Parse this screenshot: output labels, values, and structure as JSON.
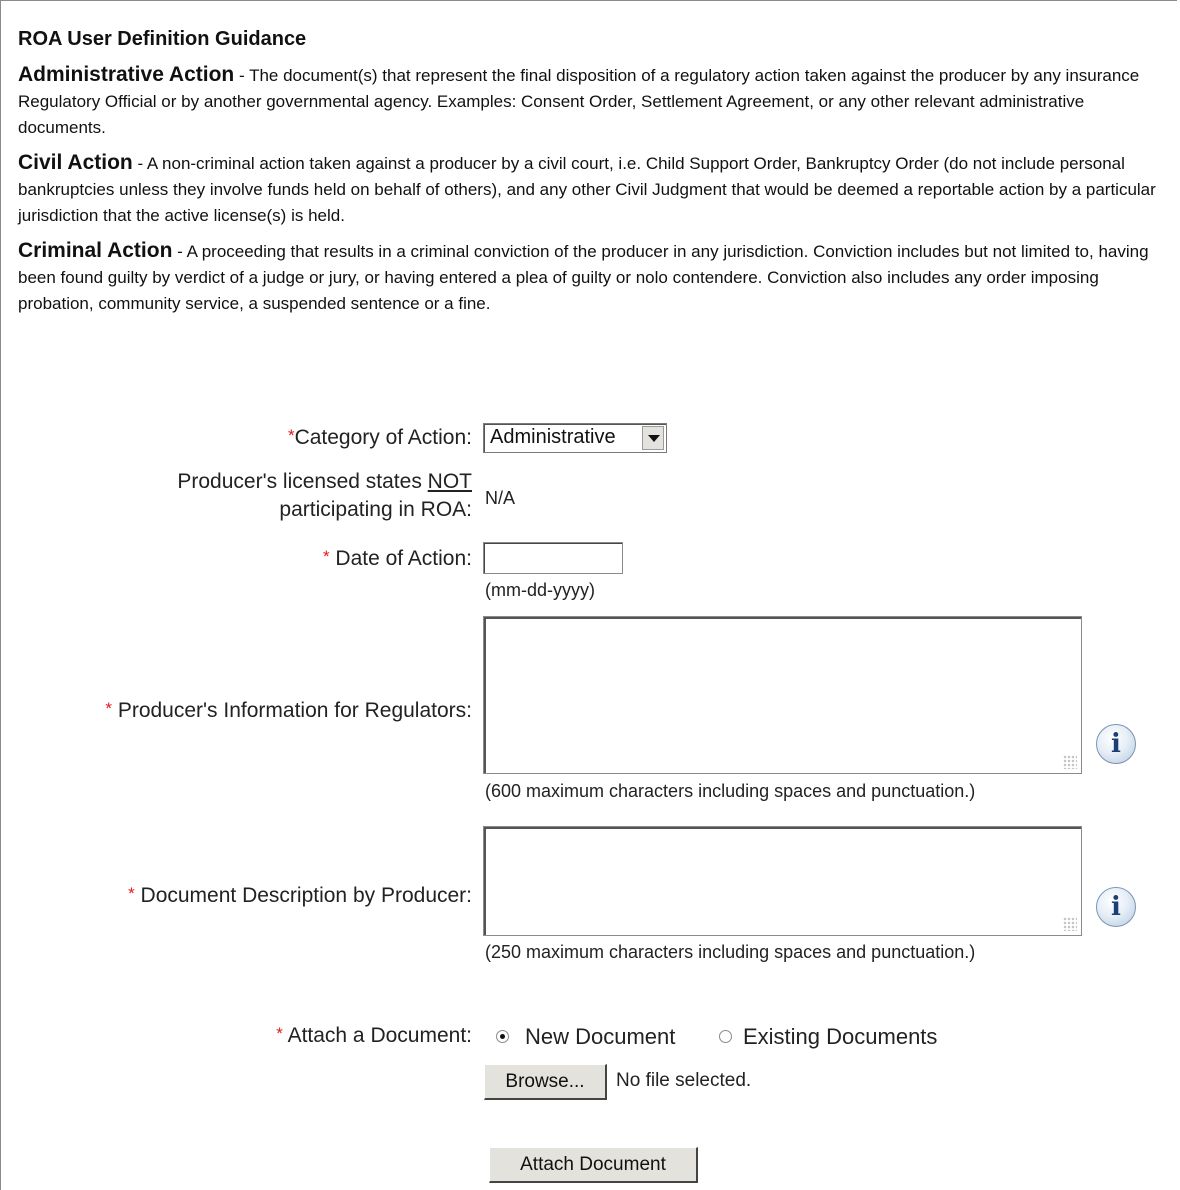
{
  "guidance": {
    "title": "ROA User Definition Guidance",
    "items": [
      {
        "term": "Administrative Action",
        "separator": " - ",
        "text": "The document(s) that represent the final disposition of a regulatory action taken against the producer by any insurance Regulatory Official or by another governmental agency. Examples: Consent Order, Settlement Agreement, or any other relevant administrative documents."
      },
      {
        "term": "Civil Action",
        "separator": " - ",
        "text": "A non-criminal action taken against a producer by a civil court, i.e. Child Support Order, Bankruptcy Order (do not include personal bankruptcies unless they involve funds held on behalf of others), and any other Civil Judgment that would be deemed a reportable action by a particular jurisdiction that the active license(s) is held."
      },
      {
        "term": "Criminal Action",
        "separator": " - ",
        "text": "A proceeding that results in a criminal conviction of the producer in any jurisdiction. Conviction includes but not limited to, having been found guilty by verdict of a judge or jury, or having entered a plea of guilty or nolo contendere. Conviction also includes any order imposing probation, community service, a suspended sentence or a fine."
      }
    ]
  },
  "form": {
    "required_mark": "*",
    "category": {
      "label": "Category of Action:",
      "selected": "Administrative"
    },
    "licensed_states": {
      "label_part1": "Producer's licensed states ",
      "label_not": "NOT",
      "label_part2": "participating in ROA:",
      "value": "N/A"
    },
    "date": {
      "label": " Date of Action:",
      "hint": "(mm-dd-yyyy)",
      "value": ""
    },
    "producer_info": {
      "label": " Producer's Information for Regulators:",
      "hint": "(600 maximum characters including spaces and punctuation.)"
    },
    "doc_desc": {
      "label": " Document Description by Producer:",
      "hint": "(250 maximum characters including spaces and punctuation.)"
    },
    "attach": {
      "label": " Attach a Document:",
      "option_new": "New Document",
      "option_existing": "Existing Documents",
      "selected": "new",
      "browse_label": "Browse...",
      "file_status": "No file selected.",
      "attach_button": "Attach Document"
    },
    "info_icon_glyph": "i"
  }
}
